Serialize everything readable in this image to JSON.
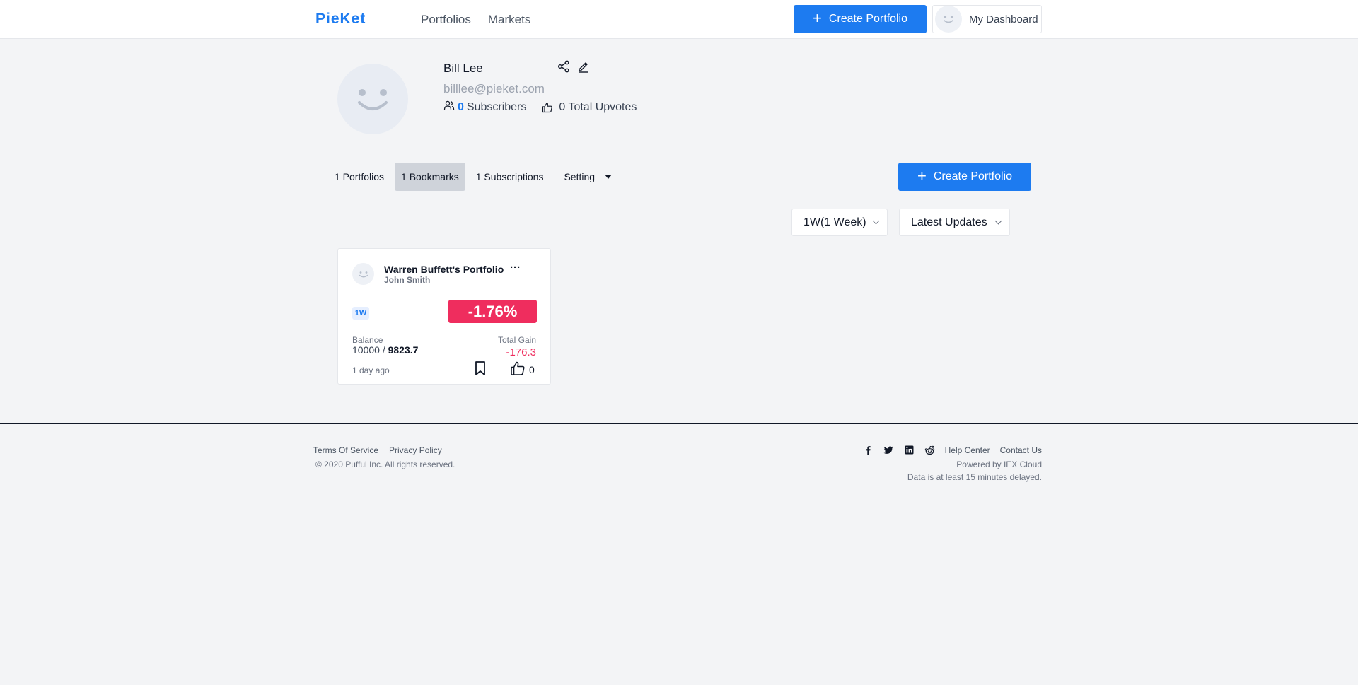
{
  "header": {
    "logo": "PieKet",
    "nav": [
      "Portfolios",
      "Markets"
    ],
    "create_label": "Create Portfolio",
    "dashboard_label": "My Dashboard"
  },
  "profile": {
    "name": "Bill Lee",
    "email": "billlee@pieket.com",
    "subscribers_count": "0",
    "subscribers_label": "Subscribers",
    "upvotes_label": "0 Total Upvotes"
  },
  "tabs": {
    "portfolios": "1 Portfolios",
    "bookmarks": "1 Bookmarks",
    "subscriptions": "1 Subscriptions",
    "setting": "Setting",
    "active": "bookmarks"
  },
  "main": {
    "create_label": "Create Portfolio"
  },
  "filters": {
    "period": "1W(1 Week)",
    "sort": "Latest Updates"
  },
  "card": {
    "title": "Warren Buffett's Portfolio",
    "more": "···",
    "owner": "John Smith",
    "period_badge": "1W",
    "change_pct": "-1.76%",
    "balance_label": "Balance",
    "balance_start": "10000",
    "balance_sep": " / ",
    "balance_current": "9823.7",
    "gain_label": "Total Gain",
    "gain_value": "-176.3",
    "updated": "1 day ago",
    "upvotes": "0"
  },
  "footer": {
    "terms": "Terms Of Service",
    "privacy": "Privacy Policy",
    "copyright": "© 2020 Pufful Inc. All rights reserved.",
    "help": "Help Center",
    "contact": "Contact Us",
    "powered": "Powered by IEX Cloud",
    "delay": "Data is at least 15 minutes delayed."
  },
  "colors": {
    "primary": "#1d7bf0",
    "negative": "#ef2d5e",
    "active_tab": "#cfd3da",
    "background": "#f3f4f6"
  },
  "icons": [
    "share-icon",
    "edit-icon",
    "users-icon",
    "thumbs-up-icon",
    "plus-icon",
    "chevron-down-icon",
    "caret-down-icon",
    "bookmark-icon",
    "facebook-icon",
    "twitter-icon",
    "linkedin-icon",
    "reddit-icon",
    "smiley-avatar-icon"
  ]
}
